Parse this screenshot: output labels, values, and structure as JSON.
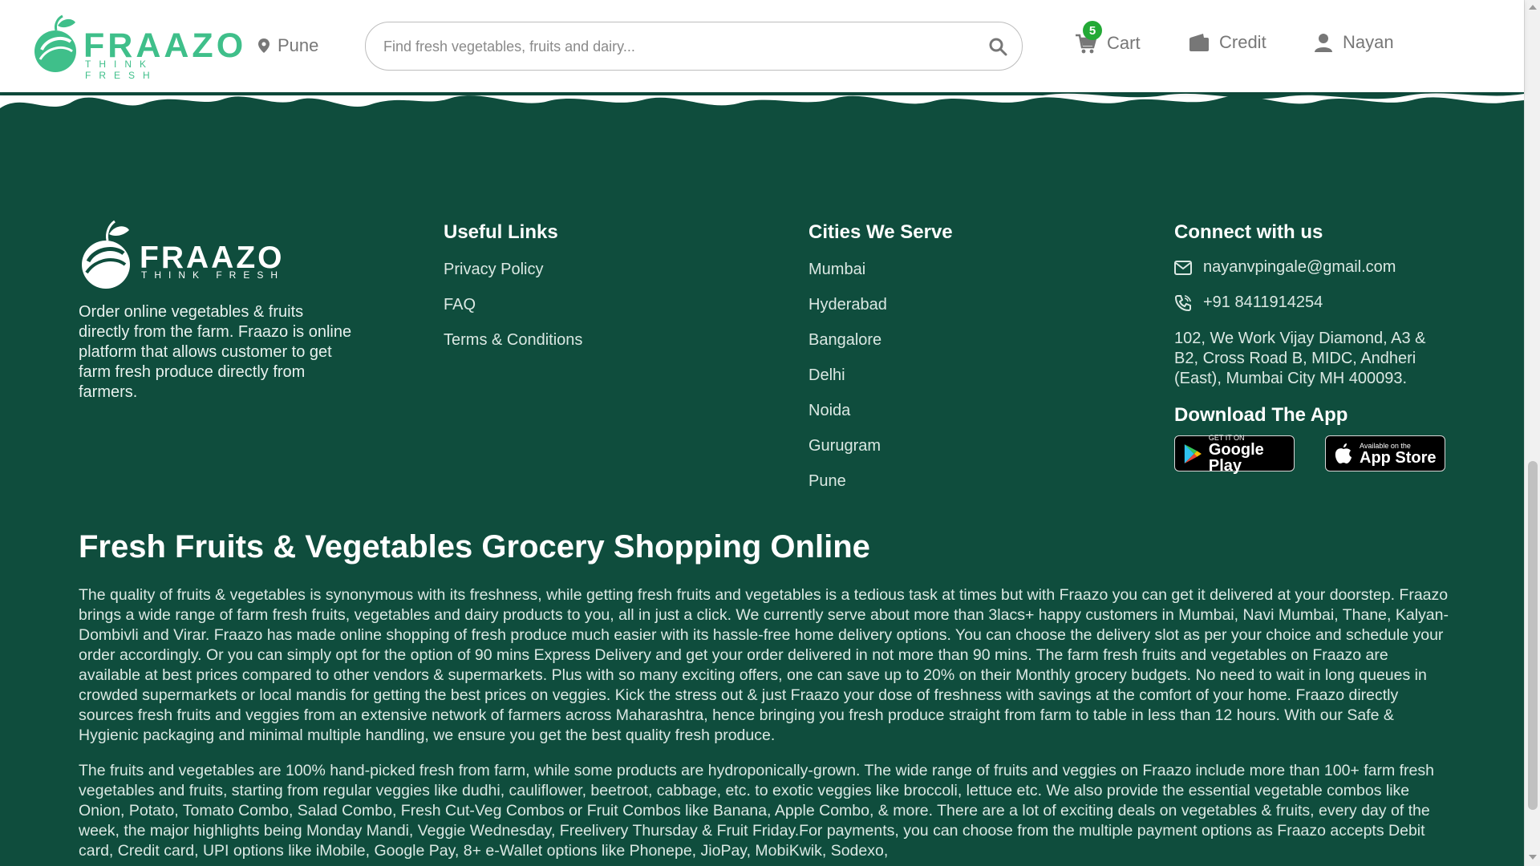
{
  "header": {
    "brand": "FRAAZO",
    "tagline": "THINK FRESH",
    "location": "Pune",
    "search_placeholder": "Find fresh vegetables, fruits and dairy...",
    "cart_label": "Cart",
    "cart_count": "5",
    "credit_label": "Credit",
    "user_label": "Nayan"
  },
  "footer": {
    "brand": "FRAAZO",
    "tagline": "THINK FRESH",
    "about": "Order online vegetables & fruits directly from the farm. Fraazo is online platform that allows customer to get farm fresh produce directly from farmers.",
    "useful_links": {
      "title": "Useful Links",
      "items": [
        "Privacy Policy",
        "FAQ",
        "Terms & Conditions"
      ]
    },
    "cities": {
      "title": "Cities We Serve",
      "items": [
        "Mumbai",
        "Hyderabad",
        "Bangalore",
        "Delhi",
        "Noida",
        "Gurugram",
        "Pune"
      ]
    },
    "connect": {
      "title": "Connect with us",
      "email": "nayanvpingale@gmail.com",
      "phone": "+91 8411914254",
      "address": "102, We Work Vijay Diamond, A3 & B2, Cross Road B, MIDC, Andheri (East), Mumbai City MH 400093."
    },
    "download": {
      "title": "Download The App",
      "google_small": "GET IT ON",
      "google_big": "Google Play",
      "apple_small": "Available on the",
      "apple_big": "App Store"
    }
  },
  "seo": {
    "title": "Fresh Fruits & Vegetables Grocery Shopping Online",
    "paragraph1": "The quality of fruits & vegetables is synonymous with its freshness, while getting fresh fruits and vegetables is a tedious task at times but with Fraazo you can get it delivered at your doorstep. Fraazo brings a wide range of farm fresh fruits, vegetables and dairy products to you, all in just a click. We currently serve about more than 3lacs+ happy customers in Mumbai, Navi Mumbai, Thane, Kalyan-Dombivli and Virar. Fraazo has made online shopping of fresh produce much easier with its hassle-free home delivery options. You can choose the delivery slot as per your choice and schedule your order accordingly. Or you can simply opt for the option of 90 mins Express Delivery and get your order delivered in not more than 90 mins. The farm fresh fruits and vegetables on Fraazo are available at best prices compared to other vendors & supermarkets. Plus with so many exciting offers, one can save up to 20% on their Monthly grocery budgets. No need to wait in long queues in crowded supermarkets or local mandis for getting the best prices on veggies. Kick the stress out & just Fraazo your dose of freshness with savings at the comfort of your home. Fraazo directly sources fresh fruits and veggies from an extensive network of farmers across Maharashtra, hence bringing you fresh produce straight from farm to table in less than 12 hours. With our Safe & Hygienic packaging and minimal multiple handling, we ensure you get the best quality fresh produce.",
    "paragraph2": "The fruits and vegetables are 100% hand-picked fresh from farm, while some products are hydroponically-grown. The wide range of fruits and veggies on Fraazo include more than 100+ farm fresh vegetables and fruits, starting from regular veggies like dudhi, cauliflower, beetroot, cabbage, etc. to exotic veggies like broccoli, lettuce etc. We also provide the essential vegetable combos like Onion, Potato, Tomato Combo, Salad Combo, Fresh Cut-Veg Combos or Fruit Combos like Banana, Apple Combo, & more. There are a lot of exciting deals on vegetables & fruits, every day of the week, the major highlights being Monday Mandi, Veggie Wednesday, Freelivery Thursday & Fruit Friday.For payments, you can choose from the multiple payment options as Fraazo accepts Debit card, Credit card, UPI options like iMobile, Google Pay, 8+ e-Wallet options like Phonepe, JioPay, MobiKwik, Sodexo,"
  },
  "colors": {
    "footer_bg": "#0f4d3d",
    "brand_green": "#3fbf8a",
    "badge_green": "#23a936"
  }
}
